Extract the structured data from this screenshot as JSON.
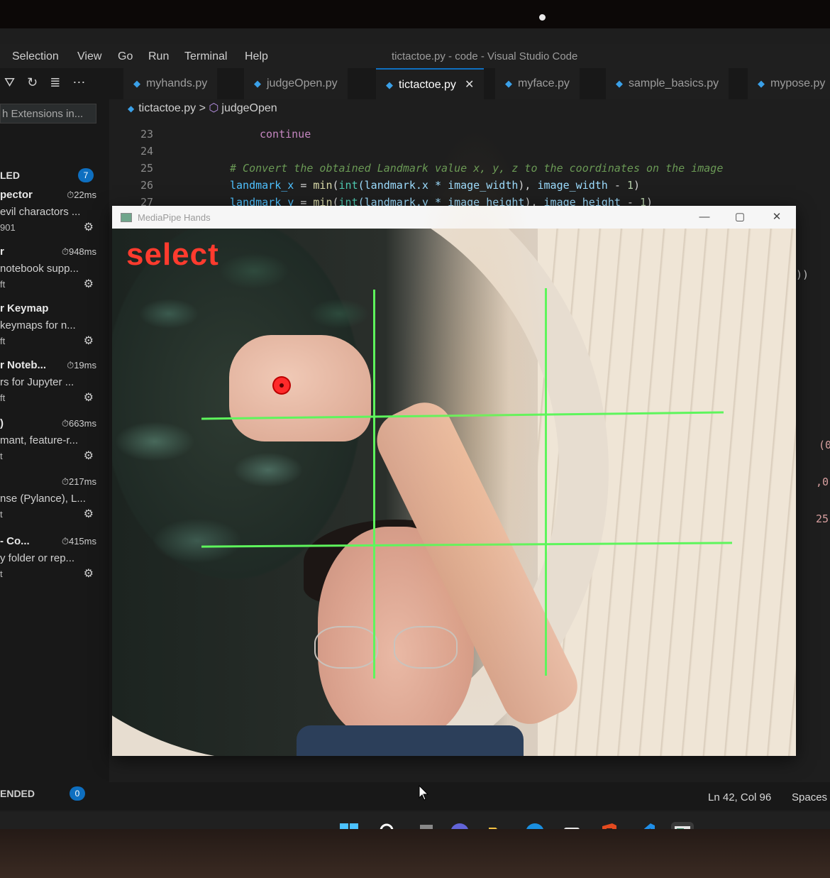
{
  "menu": {
    "items": [
      "Selection",
      "View",
      "Go",
      "Run",
      "Terminal",
      "Help"
    ],
    "window_title": "tictactoe.py - code - Visual Studio Code"
  },
  "sidebar": {
    "search_text": "h Extensions in...",
    "installed_label": "LED",
    "installed_count": "7",
    "recommended_label": "ENDED",
    "recommended_count": "0",
    "extensions": [
      {
        "name": "pector",
        "time": "22ms",
        "desc": "evil charactors ...",
        "publisher": "901"
      },
      {
        "name": "r",
        "time": "948ms",
        "desc": "notebook supp...",
        "publisher": "ft"
      },
      {
        "name": "r Keymap",
        "time": "",
        "desc": "keymaps for n...",
        "publisher": "ft"
      },
      {
        "name": "r Noteb...",
        "time": "19ms",
        "desc": "rs for Jupyter ...",
        "publisher": "ft"
      },
      {
        "name": ")",
        "time": "663ms",
        "desc": "mant, feature-r...",
        "publisher": "t"
      },
      {
        "name": "",
        "time": "217ms",
        "desc": "nse (Pylance), L...",
        "publisher": "t"
      },
      {
        "name": "- Co...",
        "time": "415ms",
        "desc": "y folder or rep...",
        "publisher": "t"
      }
    ]
  },
  "tabs": [
    {
      "label": "myhands.py",
      "active": false
    },
    {
      "label": "judgeOpen.py",
      "active": false
    },
    {
      "label": "tictactoe.py",
      "active": true
    },
    {
      "label": "myface.py",
      "active": false
    },
    {
      "label": "sample_basics.py",
      "active": false
    },
    {
      "label": "mypose.py",
      "active": false
    }
  ],
  "breadcrumb": {
    "file": "tictactoe.py",
    "symbol": "judgeOpen"
  },
  "code": {
    "line_numbers": [
      "23",
      "24",
      "25",
      "26",
      "27"
    ],
    "line23": "continue",
    "line25": "# Convert the obtained Landmark value x, y, z to the coordinates on the image",
    "line26_a": "landmark_x",
    "line26_b": " = ",
    "line26_c": "min",
    "line26_d": "(",
    "line26_e": "int",
    "line26_f": "(landmark.x * ",
    "line26_g": "image_width",
    "line26_h": "), ",
    "line26_i": "image_width",
    "line26_j": " - ",
    "line26_k": "1",
    "line26_l": ")",
    "line27_a": "landmark_y",
    "line27_f": "(landmark.y * ",
    "line27_g": "image_height",
    "line27_i": "image_height",
    "right_fragments": [
      "))",
      "(0",
      ",0,",
      "25"
    ]
  },
  "mediapipe": {
    "window_title": "MediaPipe Hands",
    "overlay_text": "select",
    "grid_color": "#5ef55c",
    "marker_color": "#ff2a2a"
  },
  "status": {
    "position": "Ln 42, Col 96",
    "spaces": "Spaces"
  },
  "taskbar": {
    "icons": [
      "windows-start-icon",
      "search-icon",
      "task-view-icon",
      "chat-icon",
      "file-explorer-icon",
      "edge-icon",
      "store-icon",
      "office-icon",
      "vscode-icon",
      "mediapipe-app-icon"
    ]
  }
}
